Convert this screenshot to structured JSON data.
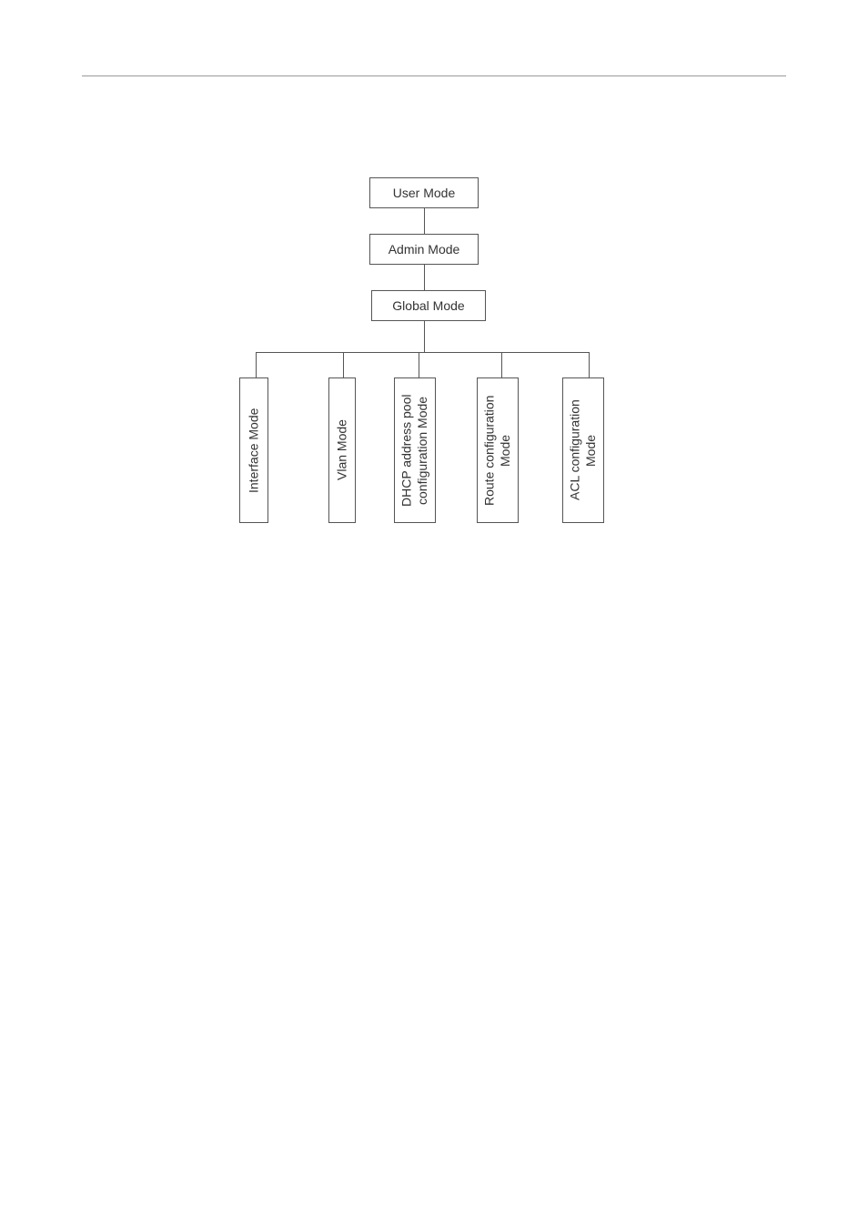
{
  "chart_data": {
    "type": "diagram",
    "structure": "hierarchy",
    "nodes": {
      "user_mode": "User Mode",
      "admin_mode": "Admin Mode",
      "global_mode": "Global Mode",
      "interface_mode": "Interface Mode",
      "vlan_mode": "Vlan Mode",
      "dhcp_mode": "DHCP address pool configuration Mode",
      "route_mode": "Route configuration Mode",
      "acl_mode": "ACL configuration Mode"
    },
    "edges": [
      [
        "user_mode",
        "admin_mode"
      ],
      [
        "admin_mode",
        "global_mode"
      ],
      [
        "global_mode",
        "interface_mode"
      ],
      [
        "global_mode",
        "vlan_mode"
      ],
      [
        "global_mode",
        "dhcp_mode"
      ],
      [
        "global_mode",
        "route_mode"
      ],
      [
        "global_mode",
        "acl_mode"
      ]
    ]
  }
}
